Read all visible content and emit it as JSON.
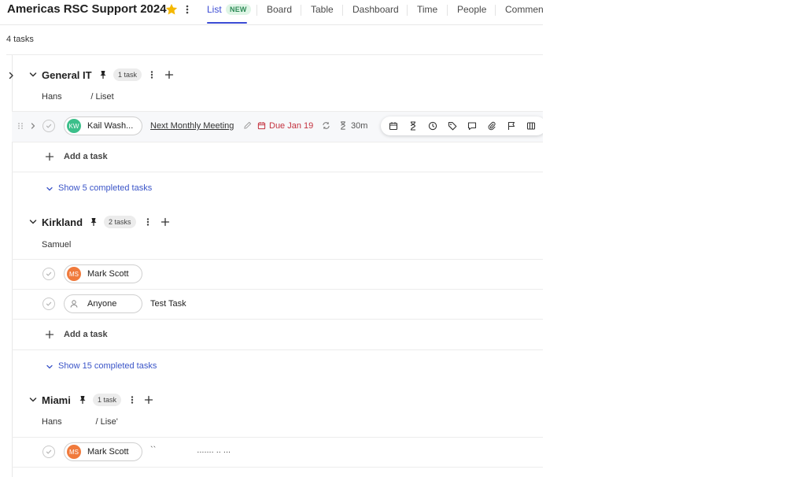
{
  "header": {
    "title": "Americas RSC Support 2024",
    "tabs": [
      {
        "label": "List",
        "active": true,
        "badge": "NEW"
      },
      {
        "label": "Board"
      },
      {
        "label": "Table"
      },
      {
        "label": "Dashboard"
      },
      {
        "label": "Time"
      },
      {
        "label": "People"
      },
      {
        "label": "Commen"
      }
    ]
  },
  "summary": {
    "task_count": "4 tasks"
  },
  "groups": [
    {
      "name": "General IT",
      "count": "1 task",
      "subtitle": "Hans            / Liset",
      "tasks": [
        {
          "assignee": "Kail Wash...",
          "initials": "KW",
          "avatar_color": "#3cbf8a",
          "name": "Next Monthly Meeting",
          "due": "Due Jan 19",
          "estimate": "30m"
        }
      ],
      "add_task": "Add a task",
      "show_completed": "Show 5 completed tasks"
    },
    {
      "name": "Kirkland",
      "count": "2 tasks",
      "subtitle": "Samuel",
      "tasks": [
        {
          "assignee": "Mark Scott",
          "initials": "MS",
          "avatar_color": "#f07a3c",
          "name": ""
        },
        {
          "assignee": "Anyone",
          "initials": "",
          "name": "Test Task"
        }
      ],
      "add_task": "Add a task",
      "show_completed": "Show 15 completed tasks"
    },
    {
      "name": "Miami",
      "count": "1 task",
      "subtitle": "Hans              / Lise'",
      "tasks": [
        {
          "assignee": "Mark Scott",
          "initials": "MS",
          "avatar_color": "#f07a3c",
          "name": "``                 ....... .. ..."
        }
      ]
    }
  ],
  "colors": {
    "accent": "#3b4bd4",
    "due": "#c4323f",
    "link": "#3b55c8",
    "star": "#f5b800"
  }
}
